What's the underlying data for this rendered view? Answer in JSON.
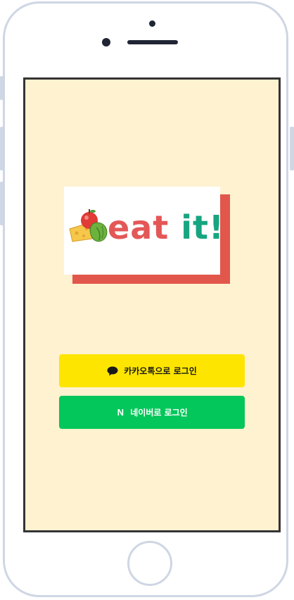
{
  "app": {
    "logo_text_part1": "eat",
    "logo_text_part2": "it!"
  },
  "login": {
    "kakao_label": "카카오톡으로 로그인",
    "naver_label": "네이버로 로그인",
    "naver_icon_letter": "N"
  },
  "icons": {
    "kakao": "chat-bubble-icon",
    "naver": "naver-n-icon",
    "logo_art": "food-icon"
  },
  "colors": {
    "background": "#fff2d0",
    "kakao_yellow": "#fee500",
    "naver_green": "#03c75a",
    "logo_red": "#e45757",
    "logo_green": "#17a581",
    "logo_shadow": "#e2574c"
  }
}
